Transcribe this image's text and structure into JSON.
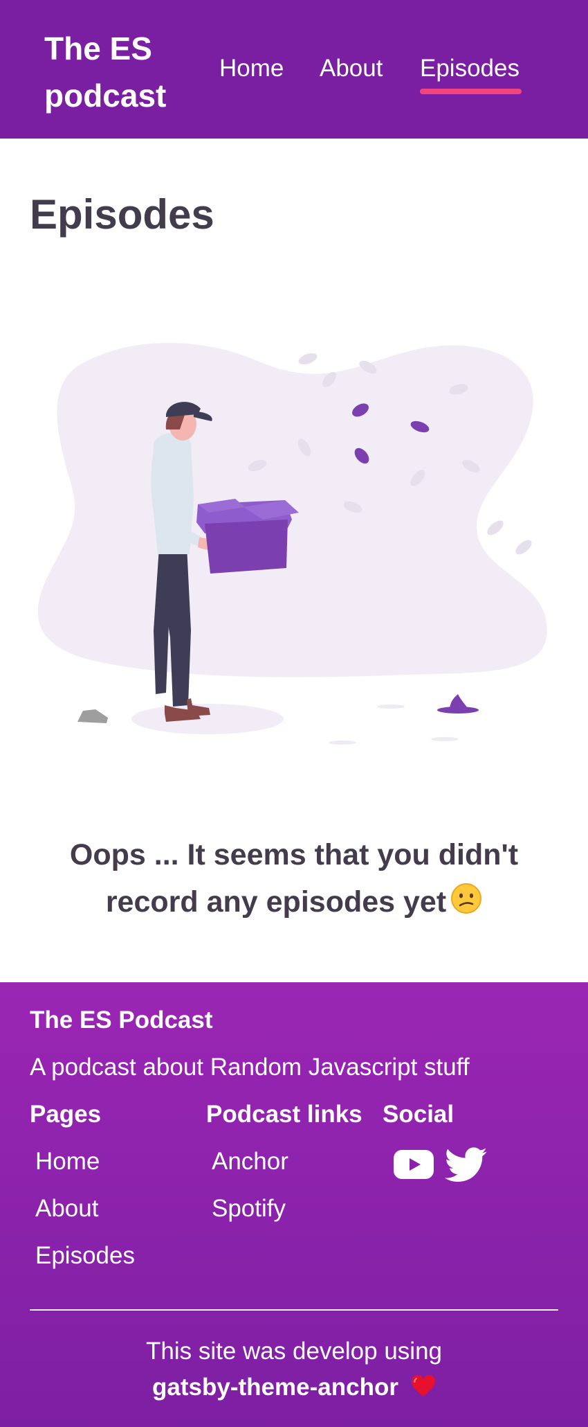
{
  "header": {
    "logo": "The ES podcast",
    "nav": [
      {
        "label": "Home"
      },
      {
        "label": "About"
      },
      {
        "label": "Episodes",
        "active": true
      }
    ]
  },
  "main": {
    "title": "Episodes",
    "illustration_icon": "man-carrying-box-illustration",
    "empty_message": "Oops ... It seems that you didn't record any episodes yet",
    "empty_emoji_icon": "confused-face-icon"
  },
  "footer": {
    "title": "The ES Podcast",
    "description": "A podcast about Random Javascript stuff",
    "pages": {
      "heading": "Pages",
      "items": [
        "Home",
        "About",
        "Episodes"
      ]
    },
    "podcast_links": {
      "heading": "Podcast links",
      "items": [
        "Anchor",
        "Spotify"
      ]
    },
    "social": {
      "heading": "Social",
      "icons": [
        "youtube-icon",
        "twitter-icon"
      ]
    },
    "credit_line": "This site was develop using",
    "credit_theme": "gatsby-theme-anchor",
    "credit_icon": "heart-icon"
  },
  "colors": {
    "header_bg": "#7b1fa2",
    "accent_underline": "#f2457f",
    "footer_bg_top": "#9a26b4",
    "footer_bg_bottom": "#7d1fa3",
    "text_dark": "#443c4c",
    "illustration_purple": "#7b3fb0"
  }
}
